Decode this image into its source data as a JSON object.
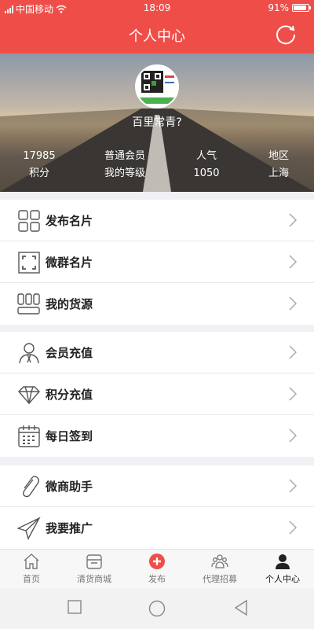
{
  "status": {
    "carrier": "中国移动",
    "time": "18:09",
    "battery": "91%",
    "battery_level": 0.91
  },
  "header": {
    "title": "个人中心"
  },
  "profile": {
    "username": "百里常青?",
    "stats": [
      {
        "value": "17985",
        "label": "积分"
      },
      {
        "value": "普通会员",
        "label": "我的等级"
      },
      {
        "value": "人气",
        "label": "1050"
      },
      {
        "value": "地区",
        "label": "上海"
      }
    ]
  },
  "menu": {
    "group1": [
      {
        "label": "发布名片",
        "icon": "grid-icon"
      },
      {
        "label": "微群名片",
        "icon": "scan-frame-icon"
      },
      {
        "label": "我的货源",
        "icon": "goods-icon"
      }
    ],
    "group2": [
      {
        "label": "会员充值",
        "icon": "member-icon"
      },
      {
        "label": "积分充值",
        "icon": "diamond-icon"
      },
      {
        "label": "每日签到",
        "icon": "calendar-icon"
      }
    ],
    "group3": [
      {
        "label": "微商助手",
        "icon": "paperclip-icon"
      },
      {
        "label": "我要推广",
        "icon": "paper-plane-icon"
      }
    ]
  },
  "tabs": [
    {
      "label": "首页",
      "icon": "home-icon"
    },
    {
      "label": "清货商城",
      "icon": "shop-icon"
    },
    {
      "label": "发布",
      "icon": "plus-circle-icon"
    },
    {
      "label": "代理招募",
      "icon": "people-icon"
    },
    {
      "label": "个人中心",
      "icon": "person-icon",
      "active": true
    }
  ],
  "colors": {
    "accent": "#ef4e48",
    "background": "#f0f1f5"
  }
}
